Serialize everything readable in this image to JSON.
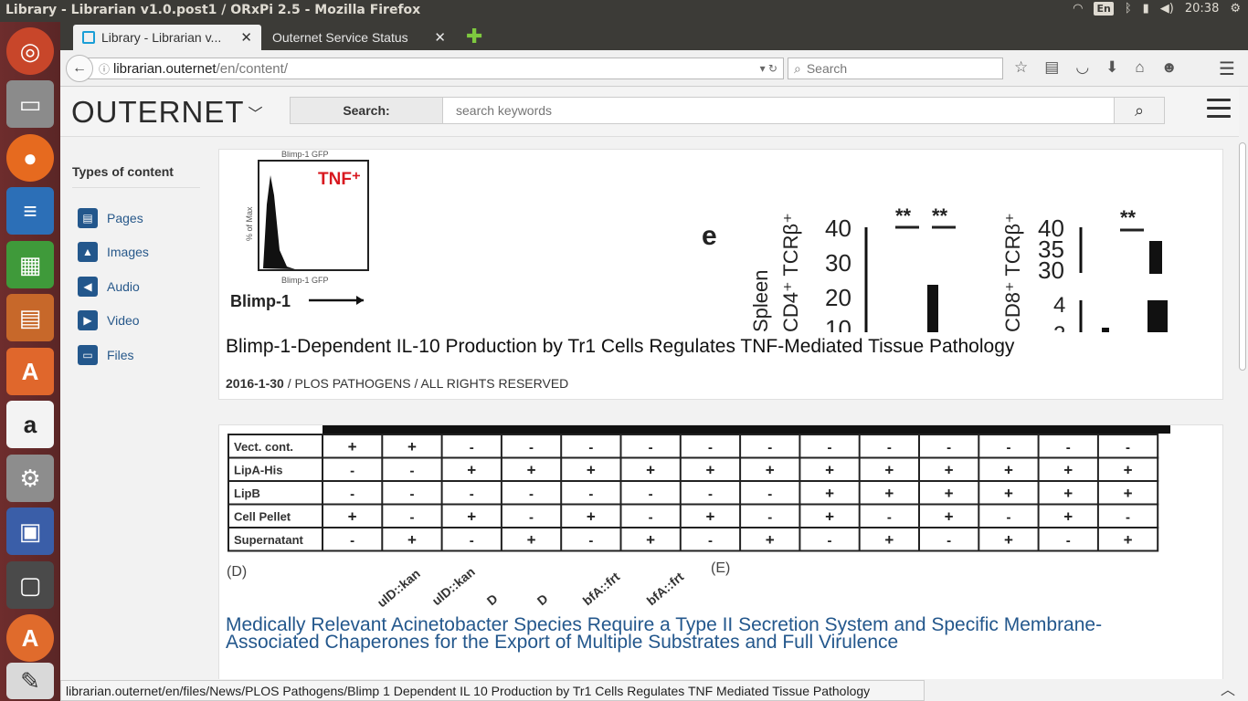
{
  "window": {
    "title": "Library - Librarian v1.0.post1 / ORxPi 2.5 - Mozilla Firefox",
    "time": "20:38",
    "keyboard": "En"
  },
  "launcher": {
    "items": [
      "ubuntu-icon",
      "files-icon",
      "firefox-icon",
      "writer-icon",
      "calc-icon",
      "impress-icon",
      "software-center-icon",
      "amazon-icon",
      "settings-icon",
      "remote-desktop-icon",
      "terminal-icon",
      "updater-icon",
      "text-editor-icon"
    ]
  },
  "tabs": [
    {
      "label": "Library - Librarian v...",
      "active": true
    },
    {
      "label": "Outernet Service Status",
      "active": false
    }
  ],
  "nav": {
    "url_host": "librarian.outernet",
    "url_path": "/en/content/",
    "search_placeholder": "Search"
  },
  "site": {
    "logo": "OUTERNET",
    "search_label": "Search:",
    "search_placeholder": "search keywords"
  },
  "sidebar": {
    "heading": "Types of content",
    "items": [
      {
        "label": "Pages",
        "icon": "pages-icon"
      },
      {
        "label": "Images",
        "icon": "images-icon"
      },
      {
        "label": "Audio",
        "icon": "audio-icon"
      },
      {
        "label": "Video",
        "icon": "video-icon"
      },
      {
        "label": "Files",
        "icon": "files-icon"
      }
    ]
  },
  "cards": [
    {
      "title": "Blimp-1-Dependent IL-10 Production by Tr1 Cells Regulates TNF-Mediated Tissue Pathology",
      "date": "2016-1-30",
      "meta": " / PLOS PATHOGENS / ALL RIGHTS RESERVED",
      "figure_text": {
        "top": "Blimp-1 GFP",
        "tnf": "TNF⁺",
        "ylab": "% of Max",
        "xlab": "Blimp-1 GFP",
        "arrow": "Blimp-1",
        "panel": "e",
        "spleen": "Spleen",
        "cd4": "CD4⁺ TCRβ⁺",
        "cd8": "CD8⁺ TCRβ⁺",
        "sig": "**"
      }
    },
    {
      "title": "Medically Relevant Acinetobacter Species Require a Type II Secretion System and Specific Membrane-Associated Chaperones for the Export of Multiple Substrates and Full Virulence",
      "table_rows": [
        {
          "label": "Vect. cont.",
          "cells": [
            "+",
            "+",
            "-",
            "-",
            "-",
            "-",
            "-",
            "-",
            "-",
            "-",
            "-",
            "-",
            "-",
            "-"
          ]
        },
        {
          "label": "LipA-His",
          "cells": [
            "-",
            "-",
            "+",
            "+",
            "+",
            "+",
            "+",
            "+",
            "+",
            "+",
            "+",
            "+",
            "+",
            "+"
          ]
        },
        {
          "label": "LipB",
          "cells": [
            "-",
            "-",
            "-",
            "-",
            "-",
            "-",
            "-",
            "-",
            "+",
            "+",
            "+",
            "+",
            "+",
            "+"
          ]
        },
        {
          "label": "Cell Pellet",
          "cells": [
            "+",
            "-",
            "+",
            "-",
            "+",
            "-",
            "+",
            "-",
            "+",
            "-",
            "+",
            "-",
            "+",
            "-"
          ]
        },
        {
          "label": "Supernatant",
          "cells": [
            "-",
            "+",
            "-",
            "+",
            "-",
            "+",
            "-",
            "+",
            "-",
            "+",
            "-",
            "+",
            "-",
            "+"
          ]
        }
      ],
      "panel_d": "(D)",
      "panel_e": "(E)"
    }
  ],
  "status_url": "librarian.outernet/en/files/News/PLOS Pathogens/Blimp 1 Dependent IL 10 Production by Tr1 Cells Regulates TNF Mediated Tissue Pathology"
}
